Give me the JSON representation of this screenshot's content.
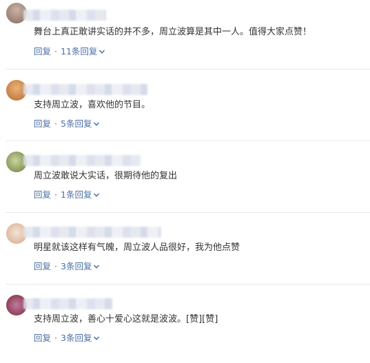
{
  "comments": [
    {
      "text": "舞台上真正敢讲实话的并不多，周立波算是其中一人。值得大家点赞！",
      "reply": "回复",
      "sep": "·",
      "count": "11条回复",
      "avatar_colors": [
        "#8a6a5a",
        "#c9b3a6"
      ]
    },
    {
      "text": "支持周立波，喜欢他的节目。",
      "reply": "回复",
      "sep": "·",
      "count": "5条回复",
      "avatar_colors": [
        "#b86a2e",
        "#e9b27a"
      ]
    },
    {
      "text": "周立波敢说大实话，很期待他的复出",
      "reply": "回复",
      "sep": "·",
      "count": "1条回复",
      "avatar_colors": [
        "#6b7a3a",
        "#c9d6a0"
      ]
    },
    {
      "text": "明星就该这样有气魄，周立波人品很好，我为他点赞",
      "reply": "回复",
      "sep": "·",
      "count": "3条回复",
      "avatar_colors": [
        "#d4a98a",
        "#f3e2d4"
      ]
    },
    {
      "text": "支持周立波，善心十爱心这就是波波。[赞][赞]",
      "reply": "回复",
      "sep": "·",
      "count": "3条回复",
      "avatar_colors": [
        "#7a2a3a",
        "#c07aa0"
      ]
    }
  ],
  "colors": {
    "link": "#4b6fa6",
    "text": "#333333",
    "divider": "#e8e8e8"
  },
  "icons": {
    "expand": "chevron-down-icon"
  }
}
